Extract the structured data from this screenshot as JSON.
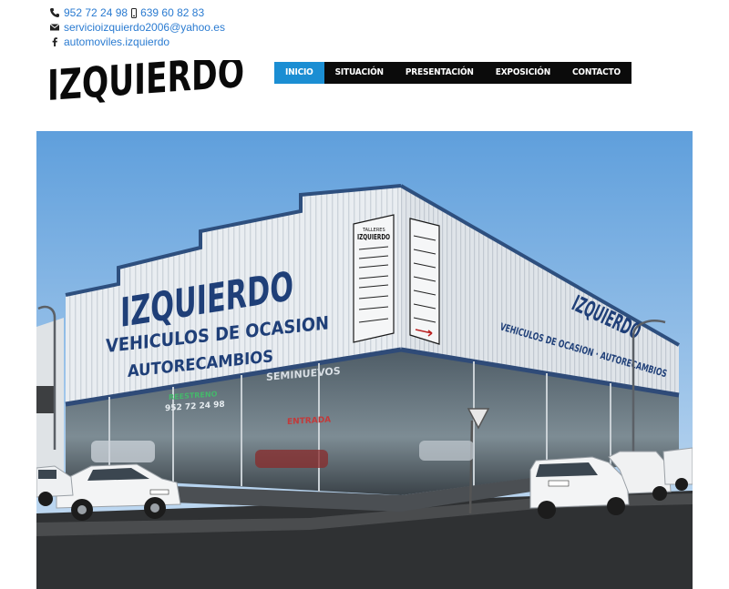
{
  "contact": {
    "phone1": "952 72 24 98",
    "phone2": "639 60 82 83",
    "email": "servicioizquierdo2006@yahoo.es",
    "facebook": "automoviles.izquierdo",
    "icons": [
      "phone-icon",
      "mobile-icon",
      "envelope-icon",
      "facebook-icon"
    ]
  },
  "logo": {
    "text": "IZQUIERDO"
  },
  "nav": {
    "items": [
      {
        "label": "INICIO",
        "active": true
      },
      {
        "label": "SITUACIÓN",
        "active": false
      },
      {
        "label": "PRESENTACIÓN",
        "active": false
      },
      {
        "label": "EXPOSICIÓN",
        "active": false
      },
      {
        "label": "CONTACTO",
        "active": false
      }
    ]
  },
  "hero": {
    "sign_main": "IZQUIERDO",
    "sign_line1": "VEHICULOS DE OCASION",
    "sign_line2": "AUTORECAMBIOS",
    "side_main": "IZQUIERDO",
    "side_line": "VEHICULOS DE OCASION · AUTORECAMBIOS",
    "board_title_small": "TALLERES",
    "board_title": "IZQUIERDO",
    "window_text1": "SEMINUEVOS",
    "window_text2": "ENTRADA",
    "window_text3": "REESTRENO",
    "window_phone": "952 72 24 98"
  },
  "colors": {
    "accent": "#1b8ed3",
    "nav_bg": "#0b0b0b",
    "link": "#2a7bd1",
    "sky_top": "#6aa6de",
    "sky_bottom": "#c6ddf2"
  }
}
